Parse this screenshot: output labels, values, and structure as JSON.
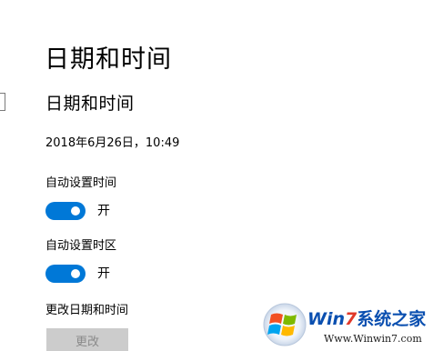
{
  "header": {
    "page_title": "日期和时间"
  },
  "section": {
    "title": "日期和时间",
    "current_datetime": "2018年6月26日，10:49"
  },
  "settings": {
    "auto_time": {
      "label": "自动设置时间",
      "state_label": "开",
      "on": true
    },
    "auto_timezone": {
      "label": "自动设置时区",
      "state_label": "开",
      "on": true
    },
    "change_datetime": {
      "label": "更改日期和时间",
      "button_label": "更改",
      "enabled": false
    }
  },
  "watermark": {
    "brand_prefix": "Win",
    "brand_seven": "7",
    "brand_suffix": "系统之家",
    "url": "Www.Winwin7.com"
  },
  "colors": {
    "accent": "#0078d7",
    "disabled_button_bg": "#cccccc",
    "disabled_button_text": "#8a8a8a"
  },
  "icons": {
    "left_edge": "search-icon",
    "watermark_logo": "windows-logo-icon"
  }
}
